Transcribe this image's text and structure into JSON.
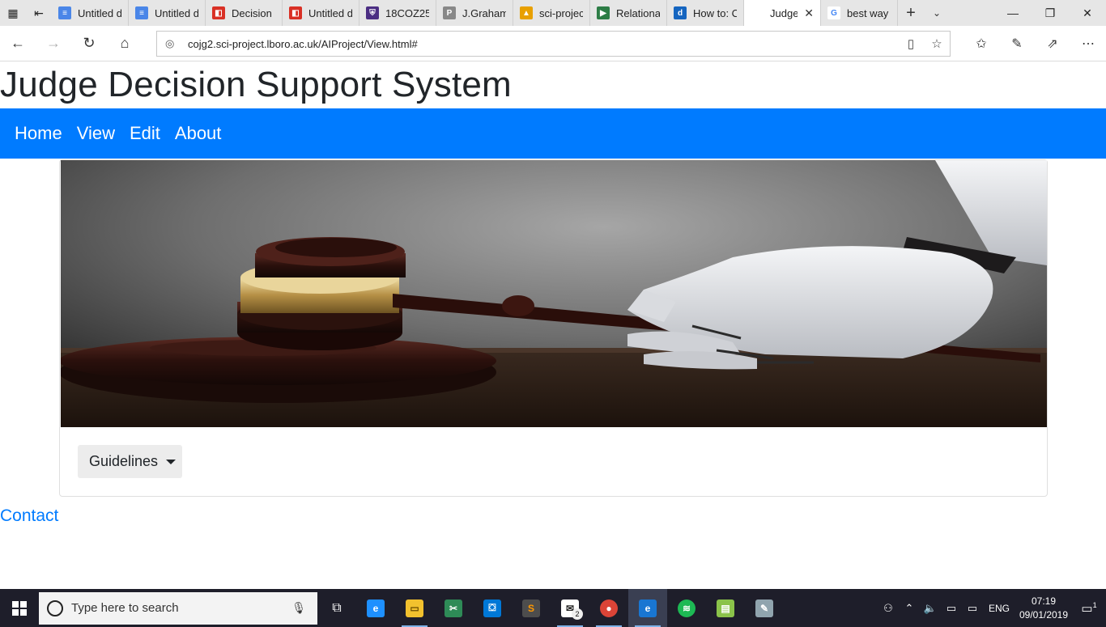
{
  "browser": {
    "tabs": [
      {
        "title": "Untitled d",
        "color": "#4a86e8",
        "glyph": "≡"
      },
      {
        "title": "Untitled d",
        "color": "#4a86e8",
        "glyph": "≡"
      },
      {
        "title": "Decision",
        "color": "#d93025",
        "glyph": "◧"
      },
      {
        "title": "Untitled d",
        "color": "#d93025",
        "glyph": "◧"
      },
      {
        "title": "18COZ25",
        "color": "#4b2e83",
        "glyph": "⛨"
      },
      {
        "title": "J.Graham",
        "color": "#888888",
        "glyph": "P"
      },
      {
        "title": "sci-projec",
        "color": "#e8a000",
        "glyph": "▲"
      },
      {
        "title": "Relationa",
        "color": "#2d7d46",
        "glyph": "▶"
      },
      {
        "title": "How to: C",
        "color": "#1565c0",
        "glyph": "d"
      },
      {
        "title": "Judge",
        "color": "#ffffff",
        "glyph": "",
        "active": true
      },
      {
        "title": "best way",
        "color": "#ffffff",
        "glyph": "G"
      }
    ],
    "url": "cojg2.sci-project.lboro.ac.uk/AIProject/View.html#"
  },
  "site": {
    "title": "Judge Decision Support System",
    "nav": [
      "Home",
      "View",
      "Edit",
      "About"
    ],
    "dropdown_label": "Guidelines",
    "contact_label": "Contact"
  },
  "taskbar": {
    "search_placeholder": "Type here to search",
    "mail_badge": "2",
    "language": "ENG",
    "time": "07:19",
    "date": "09/01/2019",
    "notifications": "1"
  },
  "colors": {
    "nav_blue": "#007bff",
    "link_blue": "#007bff",
    "title_text": "#212529"
  }
}
